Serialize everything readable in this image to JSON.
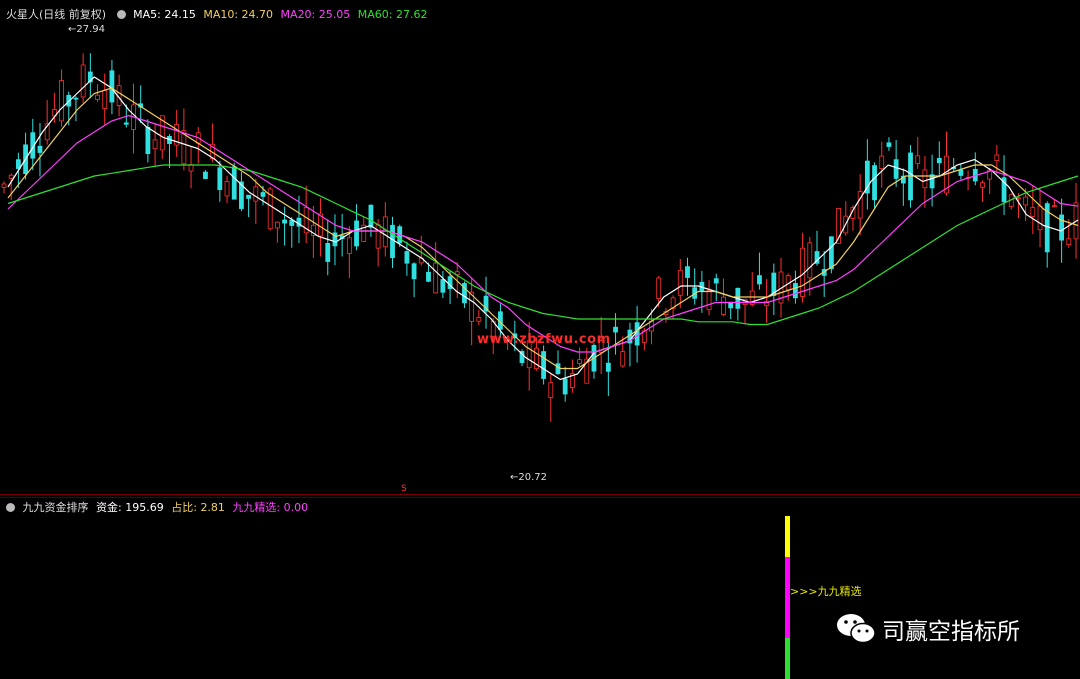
{
  "header": {
    "stock_name": "火星人(日线 前复权)",
    "ma5_label": "MA5:",
    "ma5_value": "24.15",
    "ma5_color": "#ffffff",
    "ma10_label": "MA10:",
    "ma10_value": "24.70",
    "ma10_color": "#f0d060",
    "ma20_label": "MA20:",
    "ma20_value": "25.05",
    "ma20_color": "#ff40ff",
    "ma60_label": "MA60:",
    "ma60_value": "27.62",
    "ma60_color": "#30e030"
  },
  "annotations": {
    "high_label": "27.94",
    "low_label": "20.72",
    "watermark": "www.zbzfwu.com",
    "s_marker": "S"
  },
  "sub_header": {
    "indicator_name": "九九资金排序",
    "fund_label": "资金:",
    "fund_value": "195.69",
    "fund_color": "#ffffff",
    "ratio_label": "占比:",
    "ratio_value": "2.81",
    "ratio_color": "#f0d060",
    "select_label": "九九精选:",
    "select_value": "0.00",
    "select_color": "#ff40ff"
  },
  "signal": {
    "label": ">>>九九精选",
    "segments": [
      {
        "color": "#ffff00",
        "value": 0.25
      },
      {
        "color": "#ff00ff",
        "value": 0.5
      },
      {
        "color": "#30e030",
        "value": 0.25
      }
    ]
  },
  "wechat": {
    "icon": "wechat-icon",
    "text": "司赢空指标所"
  },
  "chart_data": {
    "type": "candlestick",
    "title": "火星人(日线 前复权)",
    "ylim": [
      20.0,
      28.4
    ],
    "up_color": "#ff3030",
    "down_color": "#30e0e0",
    "max_label": 27.94,
    "min_label": 20.72,
    "series": [
      {
        "name": "MA5",
        "color": "#ffffff",
        "values": [
          25.4,
          25.9,
          26.4,
          26.8,
          27.1,
          27.4,
          27.2,
          26.8,
          26.5,
          26.3,
          26.2,
          26.1,
          25.9,
          25.6,
          25.3,
          25.1,
          24.9,
          24.7,
          24.5,
          24.4,
          24.6,
          24.7,
          24.5,
          24.3,
          24.1,
          23.8,
          23.5,
          23.3,
          23.0,
          22.6,
          22.3,
          22.1,
          21.9,
          22.0,
          22.4,
          22.5,
          22.6,
          23.0,
          23.4,
          23.6,
          23.6,
          23.5,
          23.4,
          23.3,
          23.4,
          23.6,
          23.8,
          24.1,
          24.4,
          25.0,
          25.5,
          25.8,
          25.7,
          25.5,
          25.6,
          25.8,
          25.9,
          25.7,
          25.4,
          24.9,
          24.7,
          24.6,
          24.8
        ]
      },
      {
        "name": "MA10",
        "color": "#f0d060",
        "values": [
          25.2,
          25.6,
          26.0,
          26.4,
          26.8,
          27.1,
          27.2,
          27.0,
          26.8,
          26.6,
          26.4,
          26.2,
          26.0,
          25.8,
          25.6,
          25.3,
          25.1,
          24.9,
          24.7,
          24.5,
          24.6,
          24.6,
          24.6,
          24.5,
          24.3,
          24.0,
          23.7,
          23.4,
          23.1,
          22.8,
          22.5,
          22.3,
          22.1,
          22.1,
          22.3,
          22.5,
          22.7,
          22.9,
          23.1,
          23.3,
          23.5,
          23.5,
          23.4,
          23.4,
          23.4,
          23.5,
          23.6,
          23.8,
          24.0,
          24.4,
          24.9,
          25.4,
          25.6,
          25.6,
          25.6,
          25.7,
          25.8,
          25.8,
          25.6,
          25.3,
          25.0,
          24.8,
          24.7
        ]
      },
      {
        "name": "MA20",
        "color": "#ff40ff",
        "values": [
          25.0,
          25.3,
          25.6,
          25.9,
          26.2,
          26.4,
          26.6,
          26.7,
          26.6,
          26.5,
          26.4,
          26.3,
          26.1,
          25.9,
          25.7,
          25.5,
          25.3,
          25.1,
          24.9,
          24.7,
          24.6,
          24.6,
          24.6,
          24.5,
          24.4,
          24.2,
          24.0,
          23.7,
          23.4,
          23.2,
          22.9,
          22.7,
          22.5,
          22.4,
          22.4,
          22.5,
          22.6,
          22.8,
          23.0,
          23.1,
          23.2,
          23.3,
          23.3,
          23.3,
          23.3,
          23.4,
          23.5,
          23.6,
          23.7,
          23.9,
          24.2,
          24.5,
          24.8,
          25.1,
          25.3,
          25.5,
          25.6,
          25.7,
          25.6,
          25.5,
          25.3,
          25.1,
          25.05
        ]
      },
      {
        "name": "MA60",
        "color": "#30e030",
        "values": [
          25.1,
          25.2,
          25.3,
          25.4,
          25.5,
          25.6,
          25.65,
          25.7,
          25.75,
          25.8,
          25.8,
          25.8,
          25.8,
          25.75,
          25.7,
          25.6,
          25.5,
          25.4,
          25.25,
          25.1,
          24.95,
          24.8,
          24.6,
          24.4,
          24.2,
          24.0,
          23.8,
          23.6,
          23.45,
          23.3,
          23.2,
          23.1,
          23.05,
          23.0,
          23.0,
          23.0,
          23.0,
          23.0,
          23.0,
          23.0,
          22.95,
          22.95,
          22.95,
          22.9,
          22.9,
          23.0,
          23.1,
          23.2,
          23.35,
          23.5,
          23.7,
          23.9,
          24.1,
          24.3,
          24.5,
          24.7,
          24.85,
          25.0,
          25.15,
          25.3,
          25.4,
          25.5,
          25.6
        ]
      }
    ],
    "sub_chart": {
      "indicator": "九九资金排序",
      "fund": 195.69,
      "ratio": 2.81,
      "jiujiu_select": 0.0
    }
  }
}
